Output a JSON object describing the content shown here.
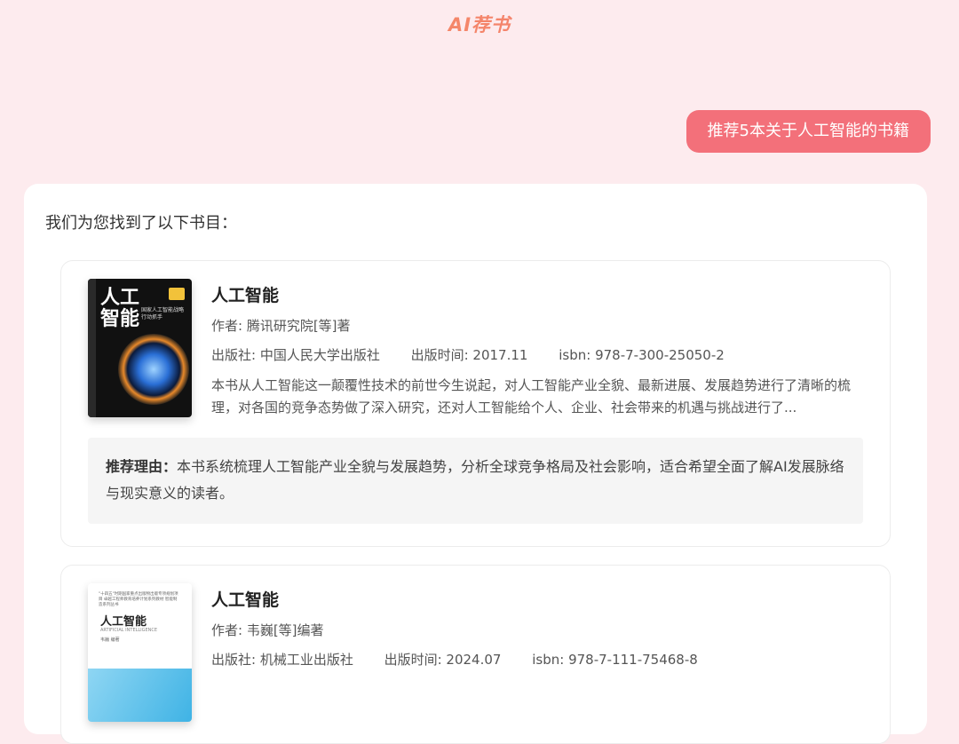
{
  "header": {
    "logo": "AI荐书"
  },
  "user_message": "推荐5本关于人工智能的书籍",
  "answer": {
    "intro": "我们为您找到了以下书目：",
    "books": [
      {
        "title": "人工智能",
        "author": "作者: 腾讯研究院[等]著",
        "publisher": "出版社: 中国人民大学出版社",
        "pub_date": "出版时间: 2017.11",
        "isbn": "isbn: 978-7-300-25050-2",
        "description": "本书从人工智能这一颠覆性技术的前世今生说起，对人工智能产业全貌、最新进展、发展趋势进行了清晰的梳理，对各国的竞争态势做了深入研究，还对人工智能给个人、企业、社会带来的机遇与挑战进行了...",
        "reason_label": "推荐理由：",
        "reason": "本书系统梳理人工智能产业全貌与发展趋势，分析全球竞争格局及社会影响，适合希望全面了解AI发展脉络与现实意义的读者。",
        "cover": {
          "title_big": "人工\n智能",
          "subtitle": "国家人工智能战略行动抓手"
        }
      },
      {
        "title": "人工智能",
        "author": "作者: 韦巍[等]编著",
        "publisher": "出版社: 机械工业出版社",
        "pub_date": "出版时间: 2024.07",
        "isbn": "isbn: 978-7-111-75468-8",
        "cover": {
          "top_text": "\"十四五\"时期国家重点出版物出版专项规划项目 卓越工程师教育培养计划系列教材 智能制造系列丛书",
          "title": "人工智能",
          "english": "ARTIFICIAL INTELLIGENCE",
          "authors": "韦巍 编著"
        }
      }
    ]
  }
}
